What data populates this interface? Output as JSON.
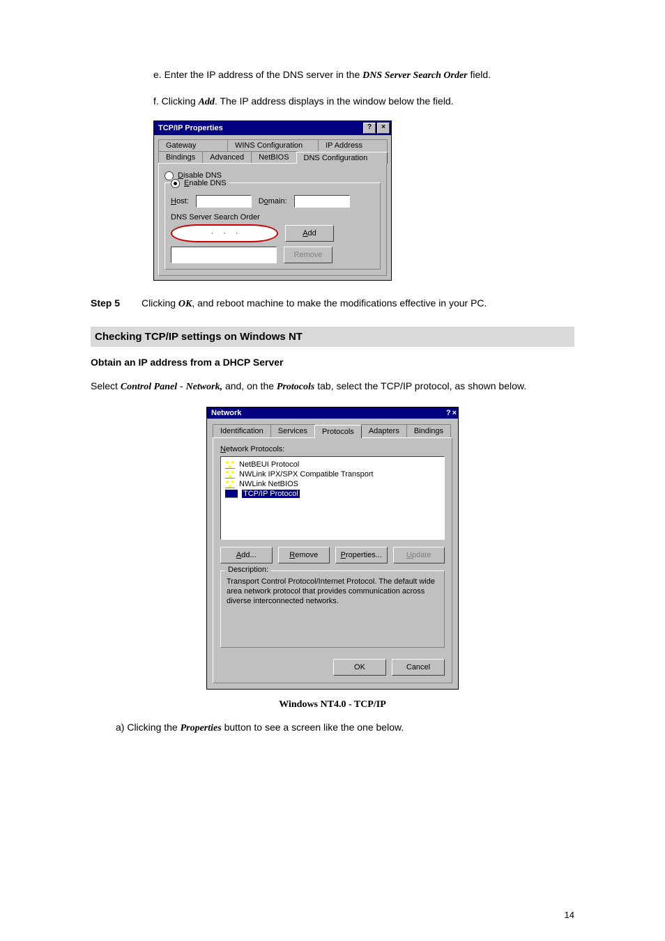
{
  "text": {
    "e_line_1": "e. Enter the IP address of the DNS server in the ",
    "e_line_em": "DNS Server Search Order",
    "e_line_2": " field.",
    "f_line_1": "f. Clicking ",
    "f_line_em": "Add",
    "f_line_2": ". The IP address displays in the window below the field.",
    "step5_label": "Step 5",
    "step5_1": "Clicking ",
    "step5_em": "OK",
    "step5_2": ", and reboot machine to make the modifications effective in your PC.",
    "section_heading": "Checking TCP/IP settings on Windows NT",
    "obtain_heading": "Obtain an IP address from a DHCP Server",
    "para2_1": "Select ",
    "para2_em1": "Control Panel",
    "para2_dash": " - ",
    "para2_em2": "Network,",
    "para2_2": " and, on the ",
    "para2_em3": "Protocols",
    "para2_3": " tab, select the TCP/IP protocol, as shown below.",
    "caption": "Windows NT4.0 - TCP/IP",
    "list_a_1": "a)   Clicking the ",
    "list_a_em": "Properties",
    "list_a_2": " button to see a screen like the one below.",
    "page_number": "14"
  },
  "tcpip": {
    "title": "TCP/IP Properties",
    "help_glyph": "?",
    "close_glyph": "×",
    "tabs_row1": {
      "gateway": "Gateway",
      "wins": "WINS Configuration",
      "ip": "IP Address"
    },
    "tabs_row2": {
      "bindings": "Bindings",
      "advanced": "Advanced",
      "netbios": "NetBIOS",
      "dns": "DNS Configuration"
    },
    "disable_dns": "Disable DNS",
    "enable_dns": "Enable DNS",
    "host_label_pre": "H",
    "host_label_post": "ost:",
    "domain_label_pre": "D",
    "domain_label_post": "omain:",
    "dns_order": "DNS Server Search Order",
    "add_btn_pre": "A",
    "add_btn_post": "dd",
    "remove_btn": "Remove",
    "dot": "·"
  },
  "network": {
    "title": "Network",
    "help_glyph": "?",
    "close_glyph": "×",
    "tabs": {
      "identification": "Identification",
      "services": "Services",
      "protocols": "Protocols",
      "adapters": "Adapters",
      "bindings": "Bindings"
    },
    "list_label_pre": "N",
    "list_label_post": "etwork Protocols:",
    "items": [
      {
        "label": "NetBEUI Protocol",
        "selected": false
      },
      {
        "label": "NWLink IPX/SPX Compatible Transport",
        "selected": false
      },
      {
        "label": "NWLink NetBIOS",
        "selected": false
      },
      {
        "label": "TCP/IP Protocol",
        "selected": true
      }
    ],
    "buttons": {
      "add_pre": "A",
      "add_post": "dd...",
      "remove_pre": "R",
      "remove_post": "emove",
      "props_pre": "P",
      "props_post": "roperties...",
      "update_pre": "U",
      "update_post": "pdate"
    },
    "desc_legend": "Description:",
    "desc_text": "Transport Control Protocol/Internet Protocol. The default wide area network protocol that provides communication across diverse interconnected networks.",
    "ok": "OK",
    "cancel": "Cancel"
  }
}
